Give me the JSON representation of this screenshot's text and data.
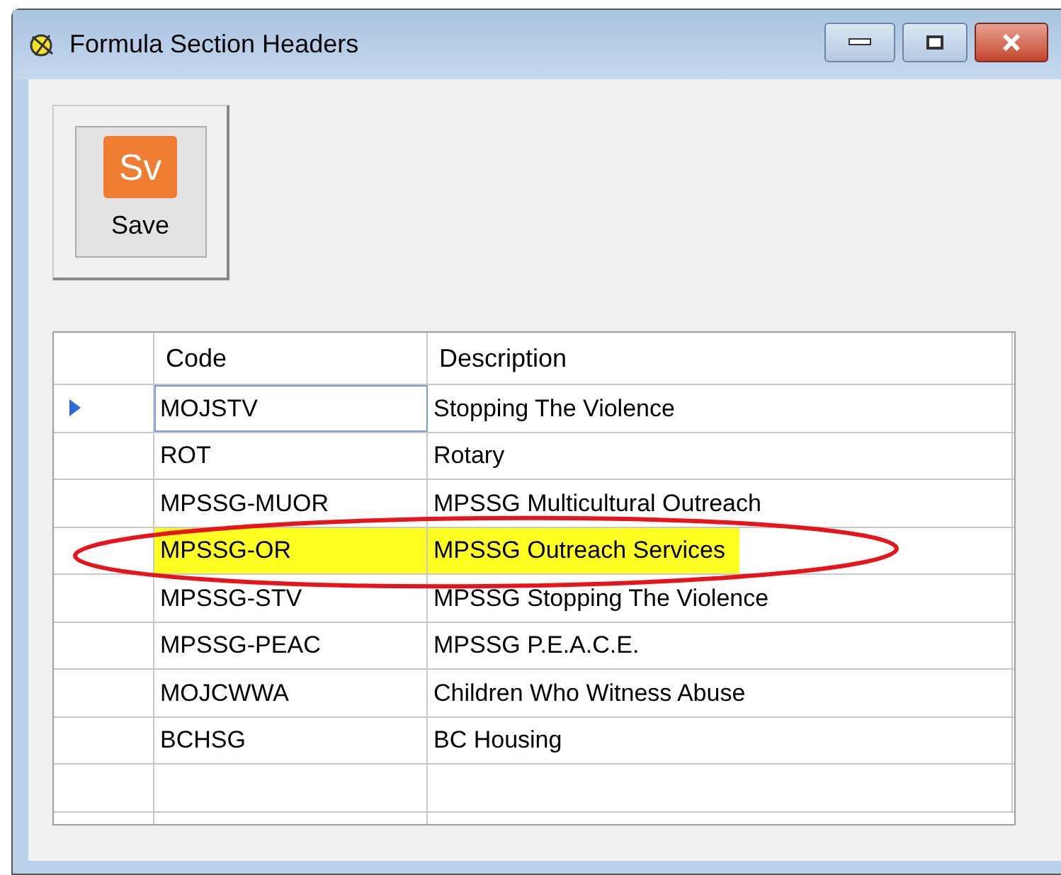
{
  "window": {
    "title": "Formula Section Headers"
  },
  "toolbar": [
    {
      "kind": "save",
      "icon_text": "Sv",
      "label": "Save"
    }
  ],
  "table": {
    "columns": [
      "Code",
      "Description"
    ],
    "rows": [
      {
        "code": "MOJSTV",
        "description": "Stopping The Violence",
        "current": true,
        "highlighted": false,
        "circled": false
      },
      {
        "code": "ROT",
        "description": "Rotary",
        "current": false,
        "highlighted": false,
        "circled": false
      },
      {
        "code": "MPSSG-MUOR",
        "description": "MPSSG Multicultural Outreach",
        "current": false,
        "highlighted": false,
        "circled": false
      },
      {
        "code": "MPSSG-OR",
        "description": "MPSSG Outreach Services",
        "current": false,
        "highlighted": true,
        "circled": true
      },
      {
        "code": "MPSSG-STV",
        "description": "MPSSG Stopping The Violence",
        "current": false,
        "highlighted": false,
        "circled": false
      },
      {
        "code": "MPSSG-PEAC",
        "description": "MPSSG P.E.A.C.E.",
        "current": false,
        "highlighted": false,
        "circled": false
      },
      {
        "code": "MOJCWWA",
        "description": "Children Who Witness Abuse",
        "current": false,
        "highlighted": false,
        "circled": false
      },
      {
        "code": "BCHSG",
        "description": "BC Housing",
        "current": false,
        "highlighted": false,
        "circled": false
      }
    ]
  }
}
